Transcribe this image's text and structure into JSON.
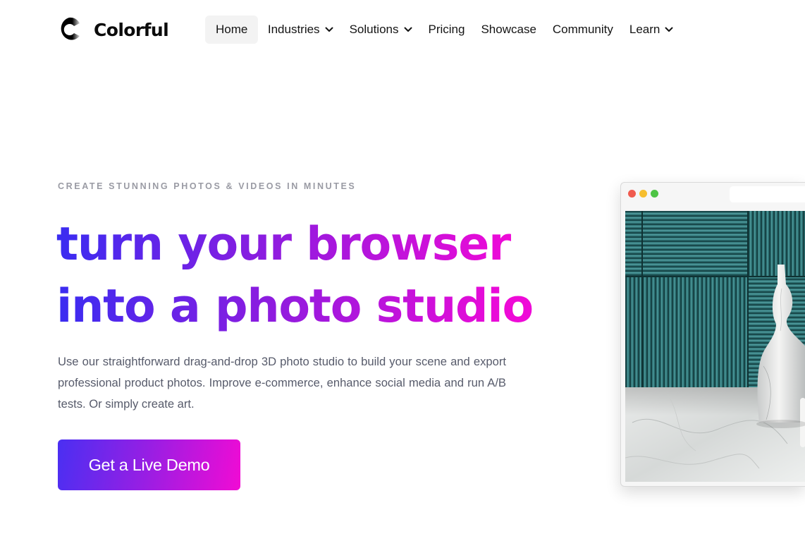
{
  "brand": {
    "name": "Colorful",
    "logo_icon": "c-logo-icon"
  },
  "nav": {
    "items": [
      {
        "label": "Home",
        "active": true,
        "has_dropdown": false
      },
      {
        "label": "Industries",
        "active": false,
        "has_dropdown": true
      },
      {
        "label": "Solutions",
        "active": false,
        "has_dropdown": true
      },
      {
        "label": "Pricing",
        "active": false,
        "has_dropdown": false
      },
      {
        "label": "Showcase",
        "active": false,
        "has_dropdown": false
      },
      {
        "label": "Community",
        "active": false,
        "has_dropdown": false
      },
      {
        "label": "Learn",
        "active": false,
        "has_dropdown": true
      }
    ]
  },
  "hero": {
    "eyebrow": "CREATE STUNNING PHOTOS & VIDEOS IN MINUTES",
    "headline_line1": "turn your browser",
    "headline_line2": "into a photo studio",
    "description": "Use our straightforward drag-and-drop 3D photo studio to build your scene and export professional product photos. Improve e-commerce, enhance social media and run A/B tests. Or simply create art.",
    "cta_label": "Get a Live Demo"
  },
  "preview": {
    "window_controls": [
      "close-dot",
      "minimize-dot",
      "maximize-dot"
    ],
    "scene": "teal-panels-marble-vase"
  },
  "colors": {
    "gradient_start": "#3a2cf1",
    "gradient_mid": "#8e1cdf",
    "gradient_end": "#ee0ad7",
    "eyebrow": "#9a9ba4",
    "body_text": "#575b6b",
    "nav_active_bg": "#f3f3f3"
  }
}
